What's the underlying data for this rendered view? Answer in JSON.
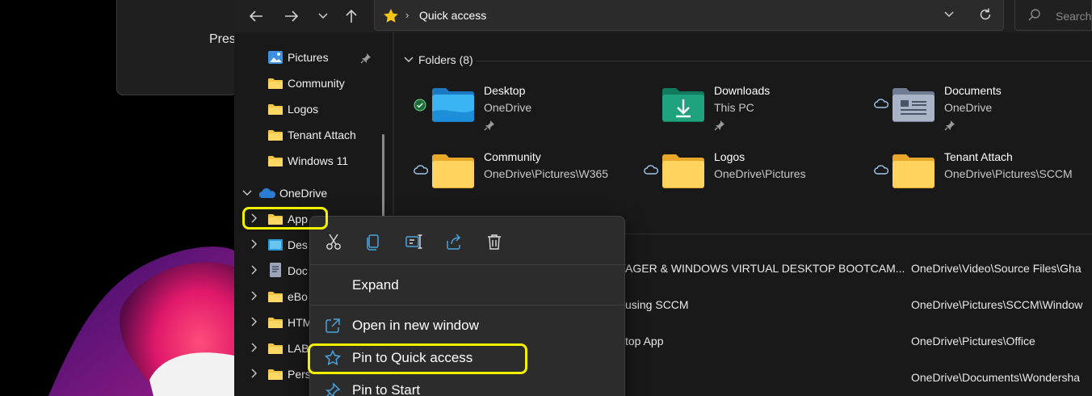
{
  "colors": {
    "highlight": "#f5f000",
    "folder": "#f5c542",
    "accent": "#4aa3df",
    "onedrive": "#2b7cd3"
  },
  "background": {
    "card_text": "Pres"
  },
  "toolbar": {
    "address": "Quick access",
    "search_placeholder": "Search"
  },
  "nav": {
    "pinned": [
      {
        "label": "Pictures",
        "icon": "pictures-icon"
      },
      {
        "label": "Community",
        "icon": "folder-icon"
      },
      {
        "label": "Logos",
        "icon": "folder-icon"
      },
      {
        "label": "Tenant Attach",
        "icon": "folder-icon"
      },
      {
        "label": "Windows 11",
        "icon": "folder-icon"
      }
    ],
    "onedrive_label": "OneDrive",
    "onedrive_children": [
      {
        "label": "App",
        "icon": "folder-icon"
      },
      {
        "label": "Des",
        "icon": "desktop-folder-icon"
      },
      {
        "label": "Doc",
        "icon": "documents-icon"
      },
      {
        "label": "eBo",
        "icon": "folder-icon"
      },
      {
        "label": "HTM",
        "icon": "folder-icon"
      },
      {
        "label": "LAB",
        "icon": "folder-icon"
      },
      {
        "label": "Pers",
        "icon": "folder-icon"
      }
    ]
  },
  "content": {
    "folders_header": "Folders (8)",
    "folders": [
      {
        "name": "Desktop",
        "location": "OneDrive",
        "status": "synced-check-icon",
        "pinned": true,
        "kind": "desktop"
      },
      {
        "name": "Downloads",
        "location": "This PC",
        "status": "",
        "pinned": true,
        "kind": "downloads"
      },
      {
        "name": "Documents",
        "location": "OneDrive",
        "status": "cloud-icon",
        "pinned": true,
        "kind": "documents"
      },
      {
        "name": "Community",
        "location": "OneDrive\\Pictures\\W365",
        "status": "cloud-icon",
        "pinned": false,
        "kind": "folder"
      },
      {
        "name": "Logos",
        "location": "OneDrive\\Pictures",
        "status": "cloud-icon",
        "pinned": false,
        "kind": "folder"
      },
      {
        "name": "Tenant Attach",
        "location": "OneDrive\\Pictures\\SCCM",
        "status": "cloud-icon",
        "pinned": false,
        "kind": "folder"
      }
    ],
    "recent": [
      {
        "name": "AGER & WINDOWS VIRTUAL DESKTOP BOOTCAM...",
        "path": "OneDrive\\Video\\Source Files\\Gha"
      },
      {
        "name": "using SCCM",
        "path": "OneDrive\\Pictures\\SCCM\\Window"
      },
      {
        "name": "top App",
        "path": "OneDrive\\Pictures\\Office"
      },
      {
        "name": "",
        "path": "OneDrive\\Documents\\Wondersha"
      }
    ]
  },
  "context_menu": {
    "actions": [
      "cut-icon",
      "copy-icon",
      "rename-icon",
      "share-icon",
      "delete-icon"
    ],
    "items": [
      {
        "label": "Expand",
        "icon": ""
      },
      {
        "label": "Open in new window",
        "icon": "open-new-window-icon"
      },
      {
        "label": "Pin to Quick access",
        "icon": "star-outline-icon"
      },
      {
        "label": "Pin to Start",
        "icon": "pin-icon"
      }
    ]
  }
}
